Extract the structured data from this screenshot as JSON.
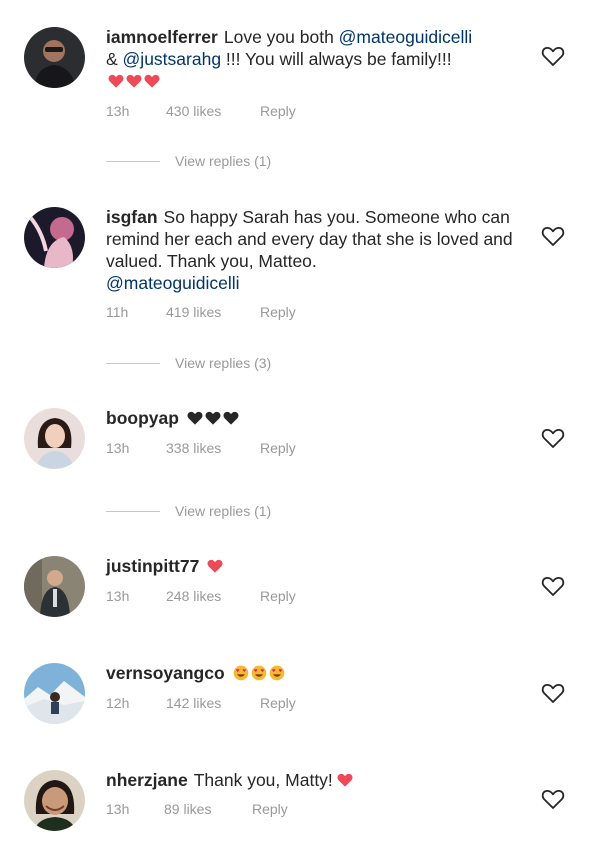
{
  "comments": [
    {
      "username": "iamnoelferrer",
      "text_before": "Love you both ",
      "mention1": "@mateoguidicelli",
      "amp": " & ",
      "mention2": "@justsarahg",
      "text_after": " !!! You will always be family!!!",
      "emojis": [
        "red-heart",
        "red-heart",
        "red-heart"
      ],
      "time": "13h",
      "likes": "430 likes",
      "reply": "Reply",
      "view_replies": "View replies (1)"
    },
    {
      "username": "isgfan",
      "text": "So happy Sarah has you. Someone who can remind her each and every day that she is loved and valued. Thank you, Matteo.",
      "mention": "@mateoguidicelli",
      "time": "11h",
      "likes": "419 likes",
      "reply": "Reply",
      "view_replies": "View replies (3)"
    },
    {
      "username": "boopyap",
      "emojis": [
        "black-heart",
        "black-heart",
        "black-heart"
      ],
      "time": "13h",
      "likes": "338 likes",
      "reply": "Reply",
      "view_replies": "View replies (1)"
    },
    {
      "username": "justinpitt77",
      "emojis": [
        "red-heart"
      ],
      "time": "13h",
      "likes": "248 likes",
      "reply": "Reply"
    },
    {
      "username": "vernsoyangco",
      "emojis": [
        "heart-eyes-face",
        "heart-eyes-face",
        "heart-eyes-face"
      ],
      "time": "12h",
      "likes": "142 likes",
      "reply": "Reply"
    },
    {
      "username": "nherzjane",
      "text": "Thank you, Matty!",
      "emojis": [
        "red-heart"
      ],
      "time": "13h",
      "likes": "89 likes",
      "reply": "Reply"
    }
  ],
  "colors": {
    "mention": "#003569",
    "meta": "#999999",
    "red_heart": "#ed4956",
    "black_heart": "#262626"
  }
}
